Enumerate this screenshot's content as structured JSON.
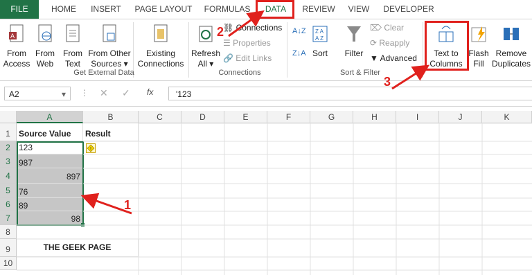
{
  "tabs": [
    "FILE",
    "HOME",
    "INSERT",
    "PAGE LAYOUT",
    "FORMULAS",
    "DATA",
    "REVIEW",
    "VIEW",
    "DEVELOPER"
  ],
  "ribbon": {
    "get_external": {
      "from_access": [
        "From",
        "Access"
      ],
      "from_web": [
        "From",
        "Web"
      ],
      "from_text": [
        "From",
        "Text"
      ],
      "from_other": [
        "From Other",
        "Sources ▾"
      ],
      "existing": [
        "Existing",
        "Connections"
      ],
      "group": "Get External Data"
    },
    "connections": {
      "refresh": [
        "Refresh",
        "All ▾"
      ],
      "connections": "Connections",
      "properties": "Properties",
      "edit_links": "Edit Links",
      "group": "Connections"
    },
    "sort_filter": {
      "sort": "Sort",
      "filter": "Filter",
      "clear": "Clear",
      "reapply": "Reapply",
      "advanced": "Advanced",
      "group": "Sort & Filter"
    },
    "data_tools": {
      "text_to_columns": [
        "Text to",
        "Columns"
      ],
      "flash_fill": [
        "Flash",
        "Fill"
      ],
      "remove_dup": [
        "Remove",
        "Duplicates"
      ]
    }
  },
  "formula_bar": {
    "name_box": "A2",
    "fx": "fx",
    "value": "'123"
  },
  "columns": [
    "A",
    "B",
    "C",
    "D",
    "E",
    "F",
    "G",
    "H",
    "I",
    "J",
    "K"
  ],
  "rows": [
    "1",
    "2",
    "3",
    "4",
    "5",
    "6",
    "7",
    "8",
    "9",
    "10"
  ],
  "cells": {
    "a1": "Source Value",
    "b1": "Result",
    "a2": "123",
    "a3": "987",
    "a4": "897",
    "a5": "76",
    "a6": "89",
    "a7": "98",
    "a9": "THE GEEK PAGE"
  },
  "annotations": {
    "n1": "1",
    "n2": "2",
    "n3": "3"
  },
  "colors": {
    "excel_green": "#217346",
    "annotation_red": "#e0211d",
    "selection": "#c6c6c6"
  }
}
